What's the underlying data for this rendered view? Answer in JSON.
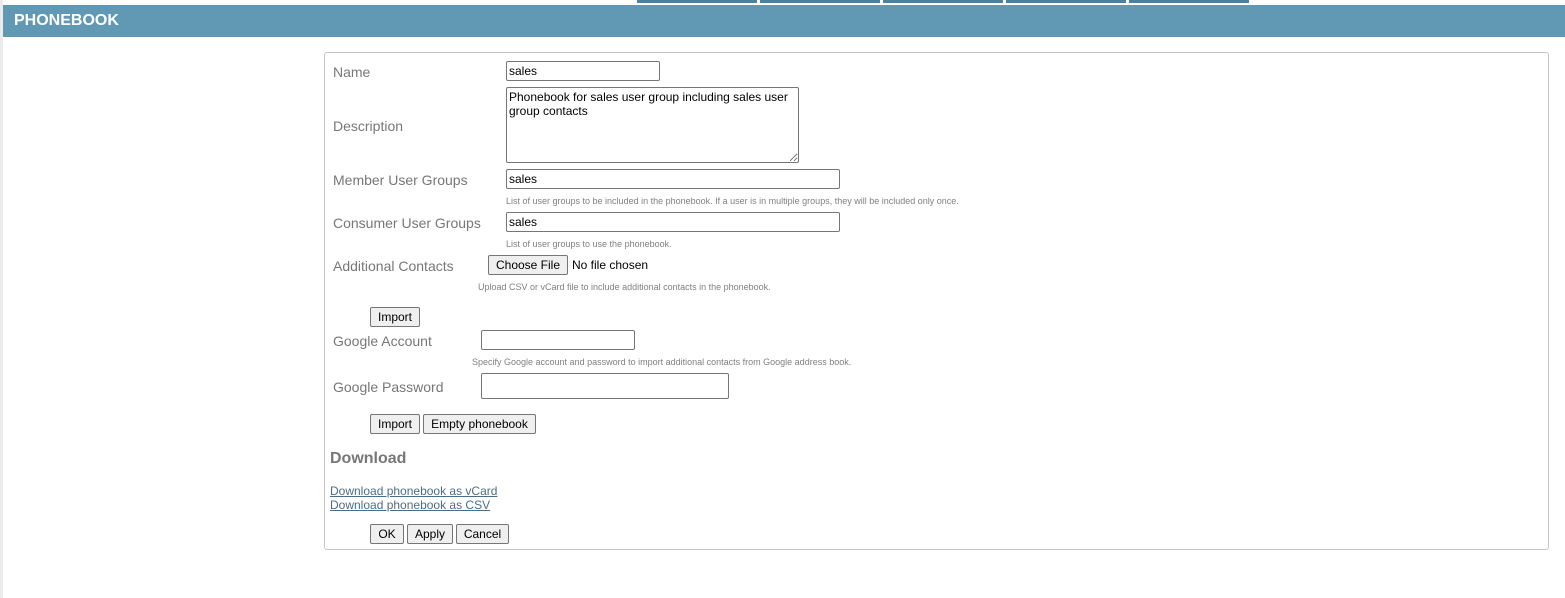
{
  "header": {
    "title": "PHONEBOOK",
    "top_tabs_count": 5
  },
  "form": {
    "name": {
      "label": "Name",
      "value": "sales"
    },
    "description": {
      "label": "Description",
      "value": "Phonebook for sales user group including sales user group contacts"
    },
    "member_user_groups": {
      "label": "Member User Groups",
      "value": "sales",
      "hint": "List of user groups to be included in the phonebook. If a user is in multiple groups, they will be included only once."
    },
    "consumer_user_groups": {
      "label": "Consumer User Groups",
      "value": "sales",
      "hint": "List of user groups to use the phonebook."
    },
    "additional_contacts": {
      "label": "Additional Contacts",
      "choose_file_label": "Choose File",
      "file_status": "No file chosen",
      "hint": "Upload CSV or vCard file to include additional contacts in the phonebook.",
      "import_label": "Import"
    },
    "google_account": {
      "label": "Google Account",
      "value": "",
      "hint": "Specify Google account and password to import additional contacts from Google address book."
    },
    "google_password": {
      "label": "Google Password",
      "value": ""
    },
    "google_import_label": "Import",
    "empty_phonebook_label": "Empty phonebook"
  },
  "download": {
    "title": "Download",
    "links": [
      {
        "label": "Download phonebook as vCard"
      },
      {
        "label": "Download phonebook as CSV"
      }
    ]
  },
  "actions": {
    "ok_label": "OK",
    "apply_label": "Apply",
    "cancel_label": "Cancel"
  },
  "colors": {
    "header_bg": "#6199b5",
    "top_tab": "#4f8099",
    "label": "#777777",
    "link": "#4a6e8a"
  }
}
